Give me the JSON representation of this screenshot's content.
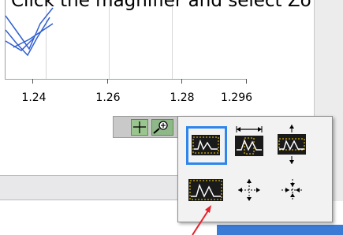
{
  "instruction": {
    "text": "Click the magnifier and select Zo"
  },
  "graph": {
    "x_ticks": [
      "1.24",
      "1.26",
      "1.28",
      "1.296"
    ]
  },
  "palette": {
    "tools": [
      {
        "name": "cursor-movement-tool",
        "icon": "crosshair-icon"
      },
      {
        "name": "zoom-tool",
        "icon": "magnifier-icon"
      }
    ]
  },
  "zoom_menu": {
    "options": [
      {
        "id": "zoom-rectangle",
        "icon": "zoom-rectangle-icon",
        "selected": true
      },
      {
        "id": "x-zoom",
        "icon": "x-zoom-icon",
        "selected": false
      },
      {
        "id": "y-zoom",
        "icon": "y-zoom-icon",
        "selected": false
      },
      {
        "id": "zoom-to-fit",
        "icon": "zoom-to-fit-icon",
        "selected": false
      },
      {
        "id": "zoom-in-about-point",
        "icon": "zoom-in-point-icon",
        "selected": false
      },
      {
        "id": "zoom-out-about-point",
        "icon": "zoom-out-point-icon",
        "selected": false
      }
    ]
  },
  "colors": {
    "selection": "#2e86ec",
    "arrow": "#e8202a",
    "trace": "#2f5fd0"
  }
}
